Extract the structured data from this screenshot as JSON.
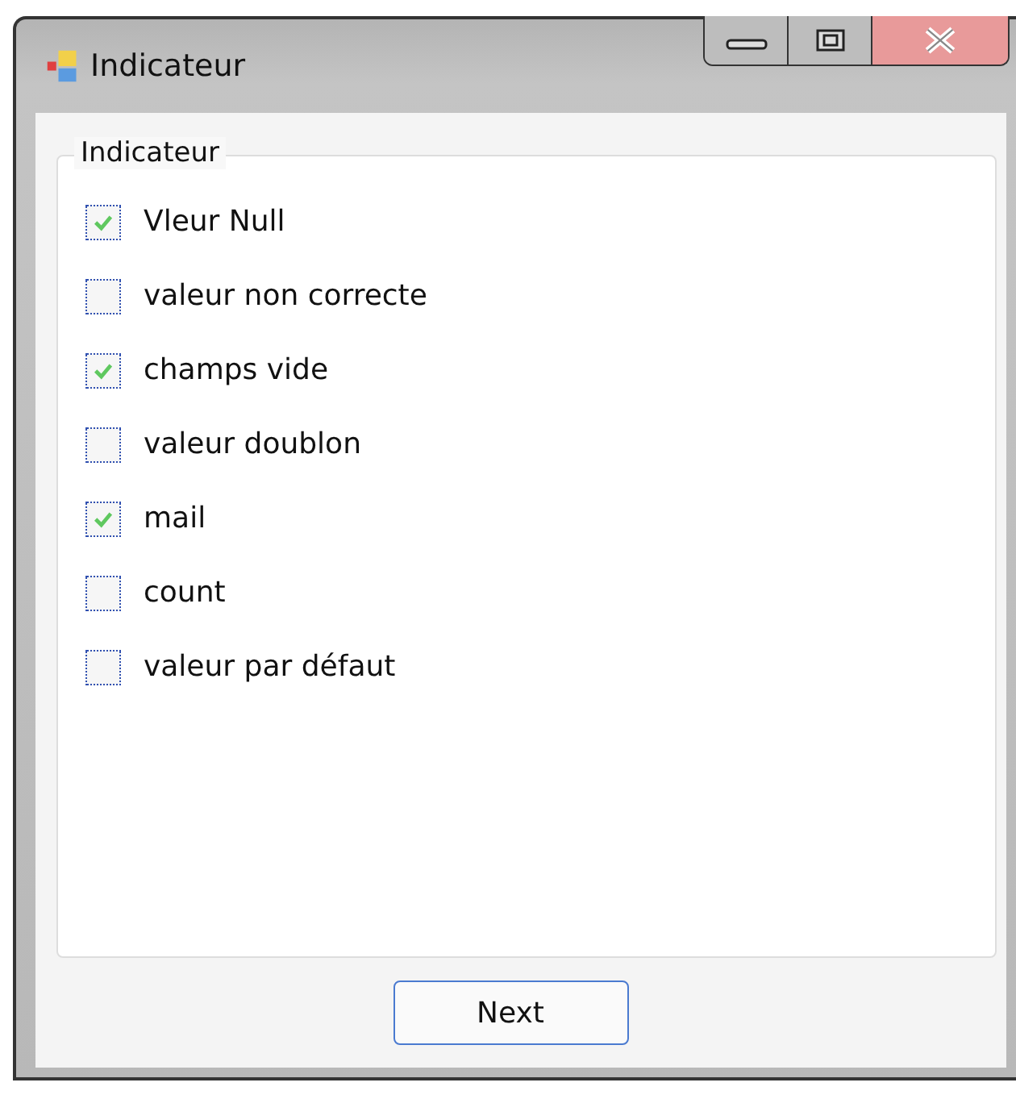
{
  "window": {
    "title": "Indicateur"
  },
  "group": {
    "label": "Indicateur"
  },
  "options": [
    {
      "label": "Vleur Null",
      "checked": true
    },
    {
      "label": "valeur non correcte",
      "checked": false
    },
    {
      "label": "champs vide",
      "checked": true
    },
    {
      "label": "valeur doublon",
      "checked": false
    },
    {
      "label": "mail",
      "checked": true
    },
    {
      "label": "count",
      "checked": false
    },
    {
      "label": "valeur par défaut",
      "checked": false
    }
  ],
  "buttons": [
    "Next"
  ]
}
